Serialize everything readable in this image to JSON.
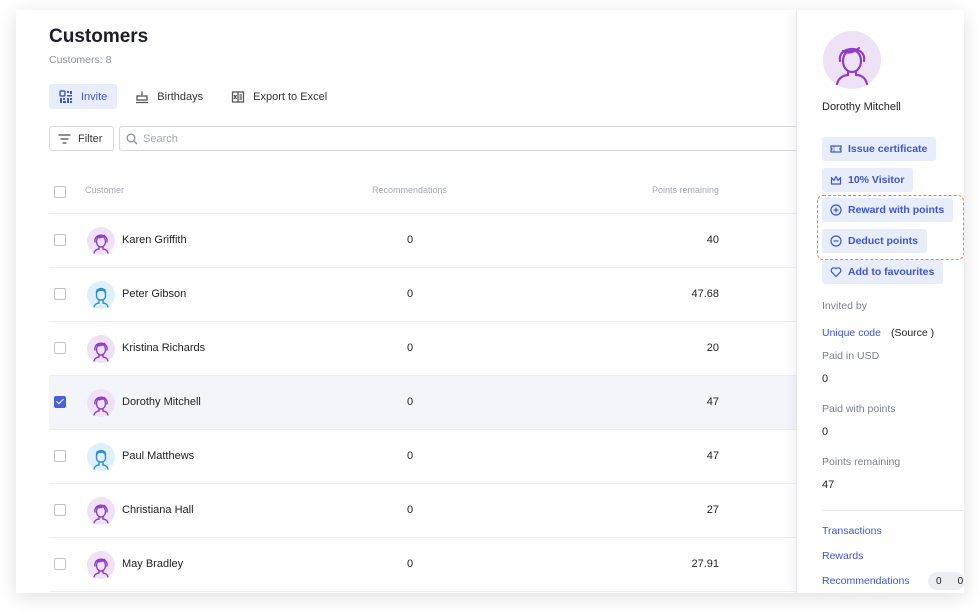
{
  "page": {
    "title": "Customers",
    "count_label": "Customers: 8"
  },
  "toolbar": {
    "invite": "Invite",
    "birthdays": "Birthdays",
    "export": "Export to Excel"
  },
  "filter": {
    "label": "Filter"
  },
  "search": {
    "placeholder": "Search"
  },
  "table": {
    "columns": {
      "customer": "Customer",
      "recommendations": "Recommendations",
      "points": "Points remaining"
    },
    "rows": [
      {
        "name": "Karen Griffith",
        "recommendations": "0",
        "points": "40",
        "avatar": "female-avatar-icon",
        "checked": false
      },
      {
        "name": "Peter Gibson",
        "recommendations": "0",
        "points": "47.68",
        "avatar": "male-avatar-icon",
        "checked": false
      },
      {
        "name": "Kristina Richards",
        "recommendations": "0",
        "points": "20",
        "avatar": "female-avatar-icon",
        "checked": false
      },
      {
        "name": "Dorothy Mitchell",
        "recommendations": "0",
        "points": "47",
        "avatar": "female-avatar-icon",
        "checked": true
      },
      {
        "name": "Paul Matthews",
        "recommendations": "0",
        "points": "47",
        "avatar": "male-avatar-icon",
        "checked": false
      },
      {
        "name": "Christiana Hall",
        "recommendations": "0",
        "points": "27",
        "avatar": "female-avatar-icon",
        "checked": false
      },
      {
        "name": "May Bradley",
        "recommendations": "0",
        "points": "27.91",
        "avatar": "female-avatar-icon",
        "checked": false
      }
    ]
  },
  "panel": {
    "name": "Dorothy Mitchell",
    "actions": {
      "issue_certificate": "Issue certificate",
      "visitor": "10% Visitor",
      "reward": "Reward with points",
      "deduct": "Deduct points",
      "favourites": "Add to favourites"
    },
    "invited_by_label": "Invited by",
    "invited_by_link": "Unique code",
    "invited_by_source": "(Source )",
    "paid_usd_label": "Paid in USD",
    "paid_usd_value": "0",
    "paid_points_label": "Paid with points",
    "paid_points_value": "0",
    "points_remaining_label": "Points remaining",
    "points_remaining_value": "47",
    "links": {
      "transactions": "Transactions",
      "rewards": "Rewards",
      "recommendations": "Recommendations"
    },
    "recommendation_counts": [
      "0",
      "0"
    ]
  },
  "colors": {
    "accent": "#3f57c9",
    "accent_bg": "#e8edfb",
    "highlight_border": "#e8843a",
    "female_avatar": "#8e3fc4",
    "male_avatar": "#2a8fd6"
  }
}
